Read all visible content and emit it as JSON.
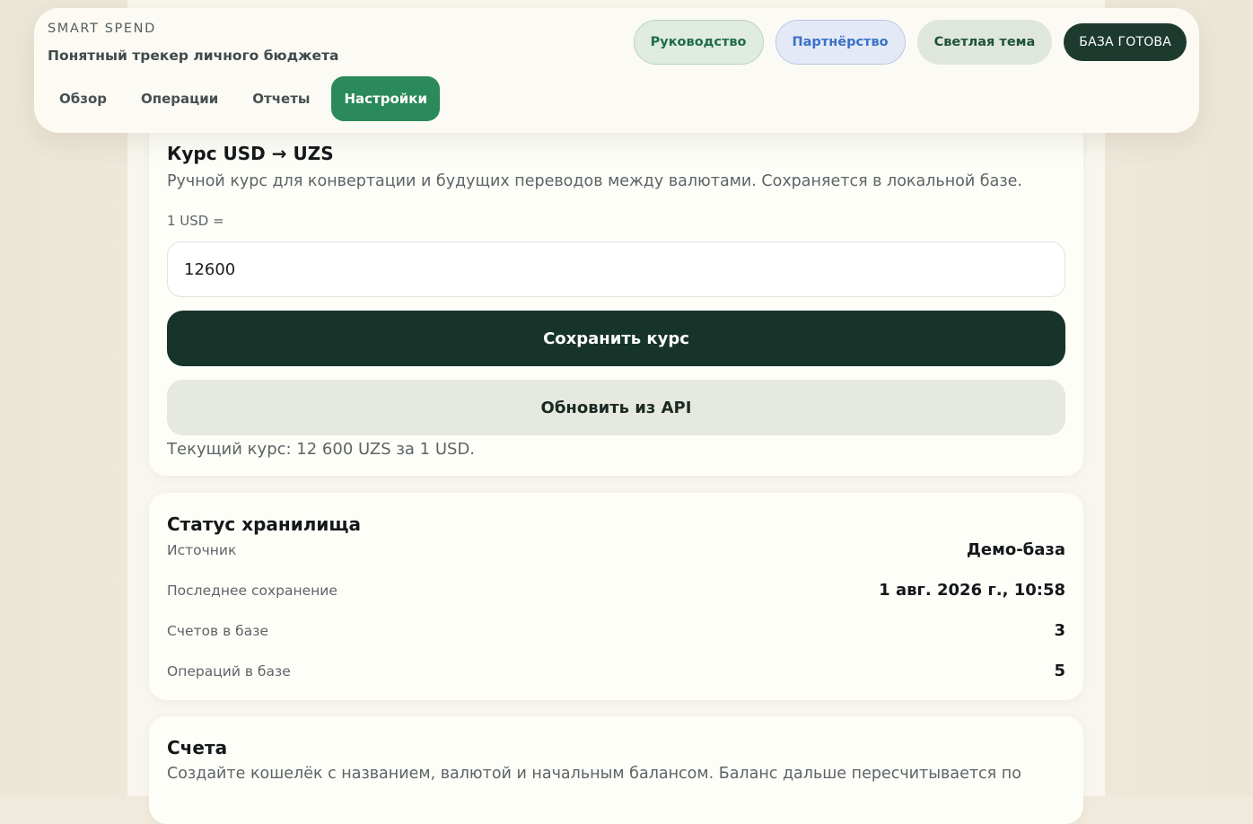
{
  "header": {
    "kicker": "SMART SPEND",
    "subtitle": "Понятный трекер личного бюджета",
    "tabs": [
      {
        "label": "Обзор",
        "active": false
      },
      {
        "label": "Операции",
        "active": false
      },
      {
        "label": "Отчеты",
        "active": false
      },
      {
        "label": "Настройки",
        "active": true
      }
    ],
    "pills": {
      "guide": "Руководство",
      "partner": "Партнёрство",
      "theme": "Светлая тема",
      "db_status": "БАЗА ГОТОВА"
    }
  },
  "rate_card": {
    "title": "Курс USD → UZS",
    "description": "Ручной курс для конвертации и будущих переводов между валютами. Сохраняется в локальной базе.",
    "input_label": "1 USD =",
    "input_value": "12600",
    "save_label": "Сохранить курс",
    "api_label": "Обновить из API",
    "current_rate": "Текущий курс: 12 600 UZS за 1 USD."
  },
  "storage_card": {
    "title": "Статус хранилища",
    "rows": [
      {
        "label": "Источник",
        "value": "Демо-база"
      },
      {
        "label": "Последнее сохранение",
        "value": "1 авг. 2026 г., 10:58"
      },
      {
        "label": "Счетов в базе",
        "value": "3"
      },
      {
        "label": "Операций в базе",
        "value": "5"
      }
    ]
  },
  "accounts_card": {
    "title": "Счета",
    "description": "Создайте кошелёк с названием, валютой и начальным балансом. Баланс дальше пересчитывается по"
  },
  "colors": {
    "accent_green": "#2b8a5a",
    "dark_green": "#17342a",
    "partner_blue": "#3a70c7"
  }
}
